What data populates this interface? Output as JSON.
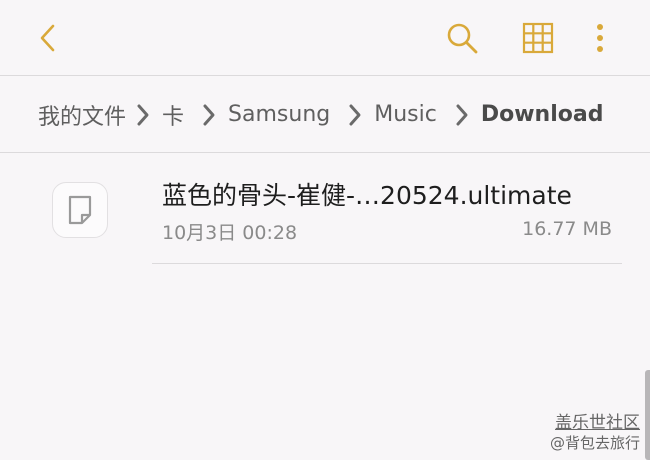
{
  "colors": {
    "accent": "#d9a93a",
    "chevron": "#6a6a6a"
  },
  "toolbar": {
    "back_icon": "chevron-left-icon",
    "search_icon": "search-icon",
    "grid_icon": "grid-view-icon",
    "more_icon": "more-vert-icon"
  },
  "breadcrumb": {
    "items": [
      "我的文件",
      "卡",
      "Samsung",
      "Music",
      "Download"
    ]
  },
  "files": [
    {
      "name": "蓝色的骨头-崔健-…20524.ultimate",
      "date": "10月3日 00:28",
      "size": "16.77 MB",
      "icon": "document-icon"
    }
  ],
  "watermark": {
    "line1": "盖乐世社区",
    "line2": "@背包去旅行"
  }
}
